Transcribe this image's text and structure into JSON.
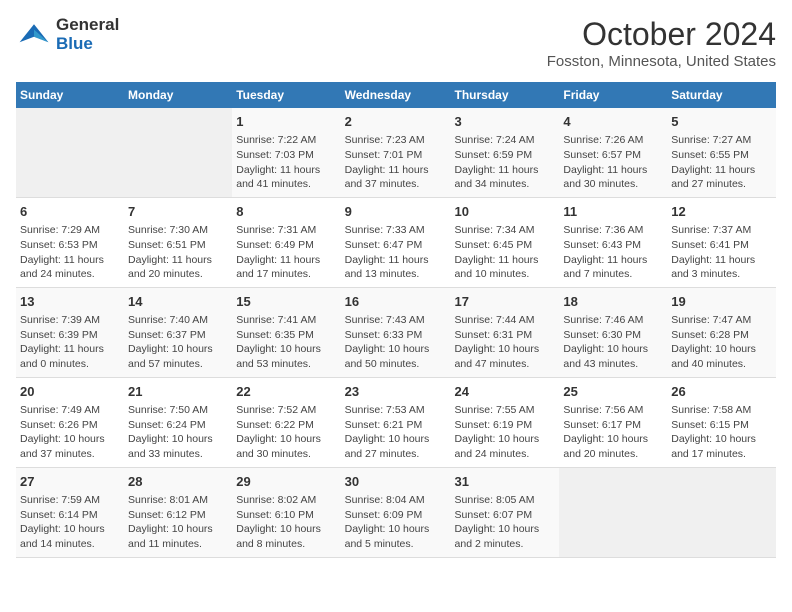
{
  "logo": {
    "line1": "General",
    "line2": "Blue"
  },
  "title": "October 2024",
  "subtitle": "Fosston, Minnesota, United States",
  "days_of_week": [
    "Sunday",
    "Monday",
    "Tuesday",
    "Wednesday",
    "Thursday",
    "Friday",
    "Saturday"
  ],
  "weeks": [
    [
      {
        "day": "",
        "sunrise": "",
        "sunset": "",
        "daylight": ""
      },
      {
        "day": "",
        "sunrise": "",
        "sunset": "",
        "daylight": ""
      },
      {
        "day": "1",
        "sunrise": "Sunrise: 7:22 AM",
        "sunset": "Sunset: 7:03 PM",
        "daylight": "Daylight: 11 hours and 41 minutes."
      },
      {
        "day": "2",
        "sunrise": "Sunrise: 7:23 AM",
        "sunset": "Sunset: 7:01 PM",
        "daylight": "Daylight: 11 hours and 37 minutes."
      },
      {
        "day": "3",
        "sunrise": "Sunrise: 7:24 AM",
        "sunset": "Sunset: 6:59 PM",
        "daylight": "Daylight: 11 hours and 34 minutes."
      },
      {
        "day": "4",
        "sunrise": "Sunrise: 7:26 AM",
        "sunset": "Sunset: 6:57 PM",
        "daylight": "Daylight: 11 hours and 30 minutes."
      },
      {
        "day": "5",
        "sunrise": "Sunrise: 7:27 AM",
        "sunset": "Sunset: 6:55 PM",
        "daylight": "Daylight: 11 hours and 27 minutes."
      }
    ],
    [
      {
        "day": "6",
        "sunrise": "Sunrise: 7:29 AM",
        "sunset": "Sunset: 6:53 PM",
        "daylight": "Daylight: 11 hours and 24 minutes."
      },
      {
        "day": "7",
        "sunrise": "Sunrise: 7:30 AM",
        "sunset": "Sunset: 6:51 PM",
        "daylight": "Daylight: 11 hours and 20 minutes."
      },
      {
        "day": "8",
        "sunrise": "Sunrise: 7:31 AM",
        "sunset": "Sunset: 6:49 PM",
        "daylight": "Daylight: 11 hours and 17 minutes."
      },
      {
        "day": "9",
        "sunrise": "Sunrise: 7:33 AM",
        "sunset": "Sunset: 6:47 PM",
        "daylight": "Daylight: 11 hours and 13 minutes."
      },
      {
        "day": "10",
        "sunrise": "Sunrise: 7:34 AM",
        "sunset": "Sunset: 6:45 PM",
        "daylight": "Daylight: 11 hours and 10 minutes."
      },
      {
        "day": "11",
        "sunrise": "Sunrise: 7:36 AM",
        "sunset": "Sunset: 6:43 PM",
        "daylight": "Daylight: 11 hours and 7 minutes."
      },
      {
        "day": "12",
        "sunrise": "Sunrise: 7:37 AM",
        "sunset": "Sunset: 6:41 PM",
        "daylight": "Daylight: 11 hours and 3 minutes."
      }
    ],
    [
      {
        "day": "13",
        "sunrise": "Sunrise: 7:39 AM",
        "sunset": "Sunset: 6:39 PM",
        "daylight": "Daylight: 11 hours and 0 minutes."
      },
      {
        "day": "14",
        "sunrise": "Sunrise: 7:40 AM",
        "sunset": "Sunset: 6:37 PM",
        "daylight": "Daylight: 10 hours and 57 minutes."
      },
      {
        "day": "15",
        "sunrise": "Sunrise: 7:41 AM",
        "sunset": "Sunset: 6:35 PM",
        "daylight": "Daylight: 10 hours and 53 minutes."
      },
      {
        "day": "16",
        "sunrise": "Sunrise: 7:43 AM",
        "sunset": "Sunset: 6:33 PM",
        "daylight": "Daylight: 10 hours and 50 minutes."
      },
      {
        "day": "17",
        "sunrise": "Sunrise: 7:44 AM",
        "sunset": "Sunset: 6:31 PM",
        "daylight": "Daylight: 10 hours and 47 minutes."
      },
      {
        "day": "18",
        "sunrise": "Sunrise: 7:46 AM",
        "sunset": "Sunset: 6:30 PM",
        "daylight": "Daylight: 10 hours and 43 minutes."
      },
      {
        "day": "19",
        "sunrise": "Sunrise: 7:47 AM",
        "sunset": "Sunset: 6:28 PM",
        "daylight": "Daylight: 10 hours and 40 minutes."
      }
    ],
    [
      {
        "day": "20",
        "sunrise": "Sunrise: 7:49 AM",
        "sunset": "Sunset: 6:26 PM",
        "daylight": "Daylight: 10 hours and 37 minutes."
      },
      {
        "day": "21",
        "sunrise": "Sunrise: 7:50 AM",
        "sunset": "Sunset: 6:24 PM",
        "daylight": "Daylight: 10 hours and 33 minutes."
      },
      {
        "day": "22",
        "sunrise": "Sunrise: 7:52 AM",
        "sunset": "Sunset: 6:22 PM",
        "daylight": "Daylight: 10 hours and 30 minutes."
      },
      {
        "day": "23",
        "sunrise": "Sunrise: 7:53 AM",
        "sunset": "Sunset: 6:21 PM",
        "daylight": "Daylight: 10 hours and 27 minutes."
      },
      {
        "day": "24",
        "sunrise": "Sunrise: 7:55 AM",
        "sunset": "Sunset: 6:19 PM",
        "daylight": "Daylight: 10 hours and 24 minutes."
      },
      {
        "day": "25",
        "sunrise": "Sunrise: 7:56 AM",
        "sunset": "Sunset: 6:17 PM",
        "daylight": "Daylight: 10 hours and 20 minutes."
      },
      {
        "day": "26",
        "sunrise": "Sunrise: 7:58 AM",
        "sunset": "Sunset: 6:15 PM",
        "daylight": "Daylight: 10 hours and 17 minutes."
      }
    ],
    [
      {
        "day": "27",
        "sunrise": "Sunrise: 7:59 AM",
        "sunset": "Sunset: 6:14 PM",
        "daylight": "Daylight: 10 hours and 14 minutes."
      },
      {
        "day": "28",
        "sunrise": "Sunrise: 8:01 AM",
        "sunset": "Sunset: 6:12 PM",
        "daylight": "Daylight: 10 hours and 11 minutes."
      },
      {
        "day": "29",
        "sunrise": "Sunrise: 8:02 AM",
        "sunset": "Sunset: 6:10 PM",
        "daylight": "Daylight: 10 hours and 8 minutes."
      },
      {
        "day": "30",
        "sunrise": "Sunrise: 8:04 AM",
        "sunset": "Sunset: 6:09 PM",
        "daylight": "Daylight: 10 hours and 5 minutes."
      },
      {
        "day": "31",
        "sunrise": "Sunrise: 8:05 AM",
        "sunset": "Sunset: 6:07 PM",
        "daylight": "Daylight: 10 hours and 2 minutes."
      },
      {
        "day": "",
        "sunrise": "",
        "sunset": "",
        "daylight": ""
      },
      {
        "day": "",
        "sunrise": "",
        "sunset": "",
        "daylight": ""
      }
    ]
  ]
}
